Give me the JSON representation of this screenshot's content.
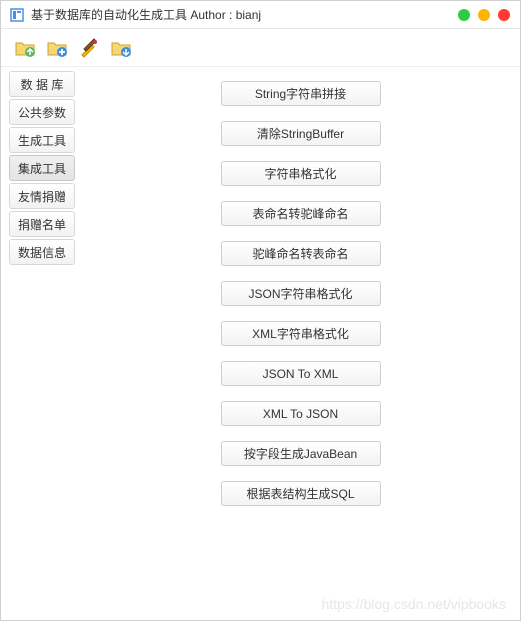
{
  "window": {
    "title": "基于数据库的自动化生成工具  Author : bianj"
  },
  "toolbar": {
    "icons": [
      "folder-up-icon",
      "folder-add-icon",
      "tools-cross-icon",
      "folder-download-icon"
    ]
  },
  "sidebar": {
    "items": [
      {
        "label": "数 据 库",
        "active": false,
        "spaced": false
      },
      {
        "label": "公共参数",
        "active": false,
        "spaced": false
      },
      {
        "label": "生成工具",
        "active": false,
        "spaced": false
      },
      {
        "label": "集成工具",
        "active": true,
        "spaced": false
      },
      {
        "label": "友情捐赠",
        "active": false,
        "spaced": false
      },
      {
        "label": "捐赠名单",
        "active": false,
        "spaced": false
      },
      {
        "label": "数据信息",
        "active": false,
        "spaced": false
      }
    ]
  },
  "actions": [
    {
      "label": "String字符串拼接"
    },
    {
      "label": "清除StringBuffer"
    },
    {
      "label": "字符串格式化"
    },
    {
      "label": "表命名转驼峰命名"
    },
    {
      "label": "驼峰命名转表命名"
    },
    {
      "label": "JSON字符串格式化"
    },
    {
      "label": "XML字符串格式化"
    },
    {
      "label": "JSON To XML"
    },
    {
      "label": "XML To JSON"
    },
    {
      "label": "按字段生成JavaBean"
    },
    {
      "label": "根据表结构生成SQL"
    }
  ],
  "watermark": "https://blog.csdn.net/vipbooks"
}
